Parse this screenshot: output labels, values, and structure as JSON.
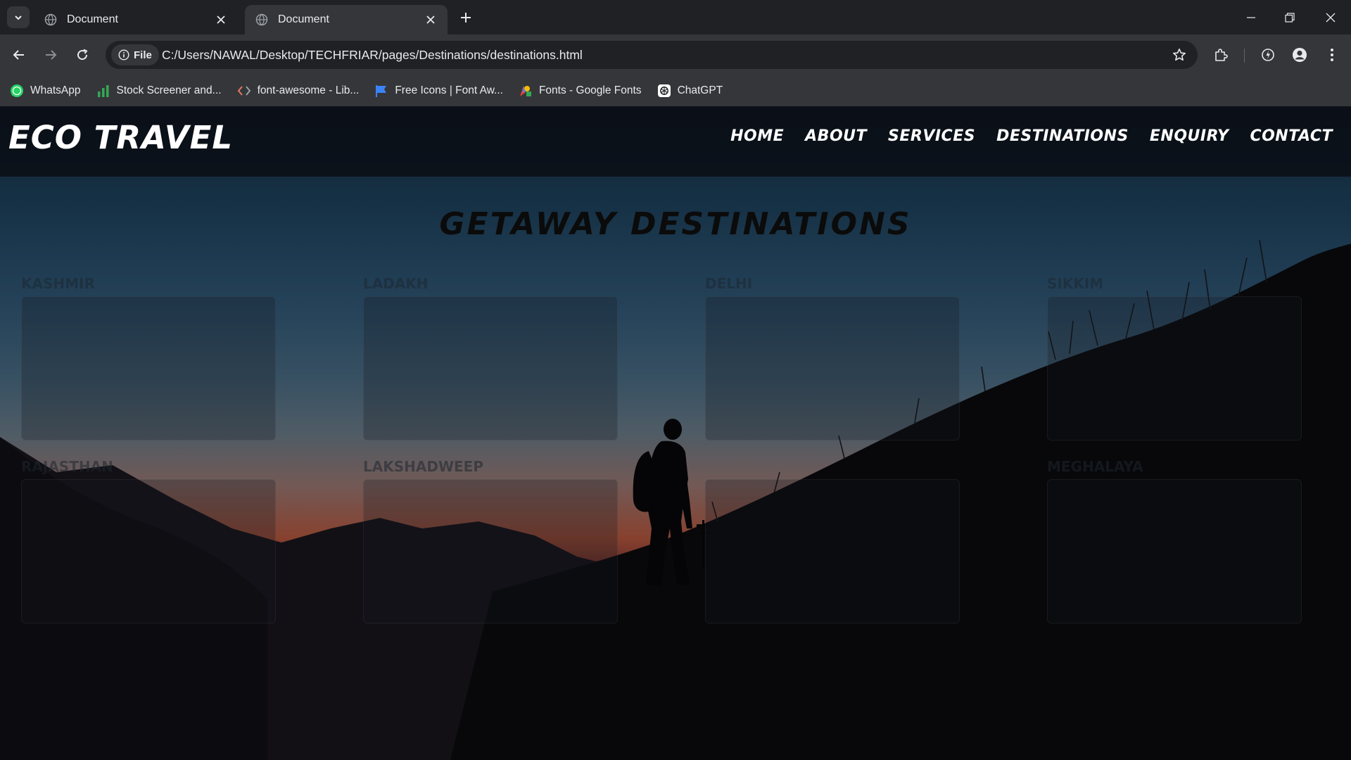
{
  "browser": {
    "tabs": [
      {
        "title": "Document",
        "active": false
      },
      {
        "title": "Document",
        "active": true
      }
    ],
    "address": {
      "scheme_chip": "File",
      "url": "C:/Users/NAWAL/Desktop/TECHFRIAR/pages/Destinations/destinations.html"
    },
    "bookmarks": [
      {
        "label": "WhatsApp",
        "icon": "whatsapp-icon"
      },
      {
        "label": "Stock Screener and...",
        "icon": "bar-chart-icon"
      },
      {
        "label": "font-awesome - Lib...",
        "icon": "code-icon"
      },
      {
        "label": "Free Icons | Font Aw...",
        "icon": "flag-icon"
      },
      {
        "label": "Fonts - Google Fonts",
        "icon": "google-fonts-icon"
      },
      {
        "label": "ChatGPT",
        "icon": "chatgpt-icon"
      }
    ]
  },
  "site": {
    "logo": "ECO TRAVEL",
    "nav": [
      "HOME",
      "ABOUT",
      "SERVICES",
      "DESTINATIONS",
      "ENQUIRY",
      "CONTACT"
    ],
    "title": "GETAWAY DESTINATIONS",
    "destinations": [
      "KASHMIR",
      "LADAKH",
      "DELHI",
      "SIKKIM",
      "RAJASTHAN",
      "LAKSHADWEEP",
      "",
      "MEGHALAYA"
    ]
  },
  "colors": {
    "chrome_dark": "#202124",
    "chrome_toolbar": "#35363a",
    "text_light": "#e8eaed",
    "header_bg": "#0a0c12",
    "sunset_orange": "#db6a4c",
    "sky_blue": "#3a6a8f"
  }
}
